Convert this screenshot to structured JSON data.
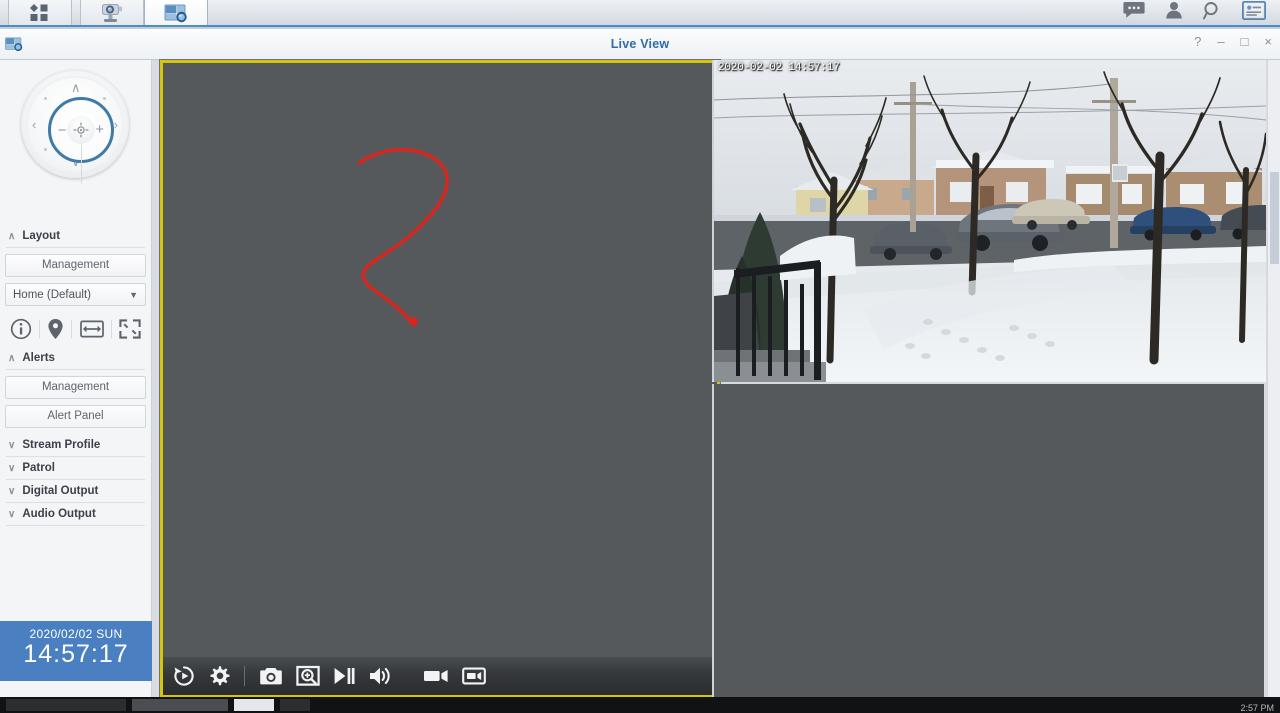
{
  "topbar": {
    "tabs": [
      {
        "name": "apps-grid",
        "icon": "apps-grid-icon",
        "active": false
      },
      {
        "name": "ip-camera",
        "icon": "ip-camera-icon",
        "active": false
      },
      {
        "name": "live-view",
        "icon": "live-view-icon",
        "active": true
      }
    ],
    "right_icons": [
      {
        "name": "chat-icon",
        "label": "chat"
      },
      {
        "name": "user-icon",
        "label": "user"
      },
      {
        "name": "search-icon",
        "label": "search"
      },
      {
        "name": "notification-panel-icon",
        "label": "panel"
      }
    ]
  },
  "window": {
    "title": "Live View",
    "icon": "live-view-icon",
    "controls": {
      "help": "?",
      "minimize": "–",
      "maximize": "□",
      "close": "×"
    }
  },
  "sidebar": {
    "ptz": {
      "name": "ptz-joystick",
      "up": "∧",
      "down": "∨",
      "left": "‹",
      "right": "›",
      "zoom_out": "−",
      "zoom_in": "+"
    },
    "sections": [
      {
        "id": "layout",
        "label": "Layout",
        "expanded": true,
        "chevron": "∧",
        "buttons": [
          {
            "name": "layout-management-button",
            "label": "Management"
          }
        ],
        "select": {
          "name": "layout-select",
          "value": "Home (Default)",
          "caret": "▼"
        },
        "icons": [
          {
            "name": "info-icon"
          },
          {
            "name": "map-pin-icon"
          },
          {
            "name": "fit-width-icon"
          },
          {
            "name": "fullscreen-icon"
          }
        ]
      },
      {
        "id": "alerts",
        "label": "Alerts",
        "expanded": true,
        "chevron": "∧",
        "buttons": [
          {
            "name": "alerts-management-button",
            "label": "Management"
          },
          {
            "name": "alert-panel-button",
            "label": "Alert Panel"
          }
        ]
      },
      {
        "id": "stream-profile",
        "label": "Stream Profile",
        "expanded": false,
        "chevron": "∨"
      },
      {
        "id": "patrol",
        "label": "Patrol",
        "expanded": false,
        "chevron": "∨"
      },
      {
        "id": "digital-output",
        "label": "Digital Output",
        "expanded": false,
        "chevron": "∨"
      },
      {
        "id": "audio-output",
        "label": "Audio Output",
        "expanded": false,
        "chevron": "∨"
      }
    ],
    "clock": {
      "date": "2020/02/02  SUN",
      "time": "14:57:17"
    }
  },
  "stage": {
    "main_cell": {
      "name": "video-cell-selected",
      "selected": true,
      "border_color": "#d6c60b",
      "background": "#56595c",
      "annotation": {
        "name": "red-ink-annotation",
        "color": "#d9251d",
        "shape": "question-mark"
      },
      "toolbar": [
        {
          "name": "playback-history-icon",
          "label": "playback"
        },
        {
          "name": "gear-settings-icon",
          "label": "settings"
        },
        {
          "name": "snapshot-camera-icon",
          "label": "snapshot"
        },
        {
          "name": "digital-zoom-icon",
          "label": "digital zoom"
        },
        {
          "name": "play-pause-icon",
          "label": "play/pause"
        },
        {
          "name": "speaker-volume-icon",
          "label": "audio"
        },
        {
          "name": "record-camcorder-icon",
          "label": "record"
        },
        {
          "name": "manual-recording-icon",
          "label": "manual recording"
        }
      ]
    },
    "camera_cell": {
      "name": "video-cell-camera",
      "timestamp": "2020-02-02 14:57:17",
      "scene": "snowy residential street with parked cars and bare trees"
    },
    "empty_cell": {
      "name": "video-cell-empty",
      "background": "#56595c"
    }
  },
  "scrollbar": {
    "name": "vertical-scrollbar"
  },
  "taskbar": {
    "clock": "2:57 PM"
  },
  "colors": {
    "accent": "#4a7fc1",
    "selection": "#d6c60b",
    "title": "#2f6ca8",
    "panel": "#f4f5f7",
    "video_bg": "#56595c"
  }
}
